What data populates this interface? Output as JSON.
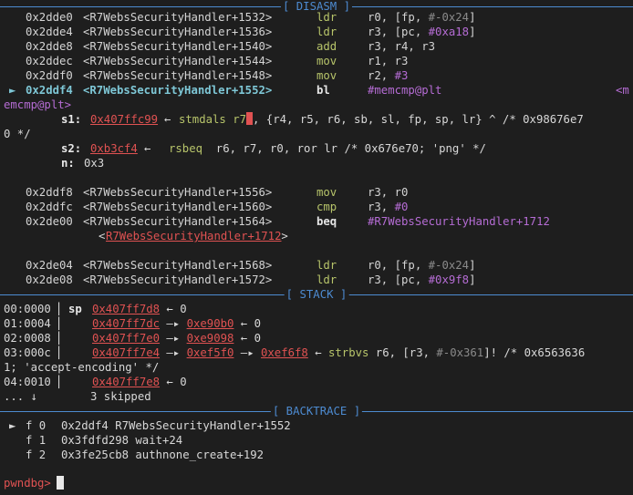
{
  "disasm": {
    "title": "[ DISASM ]",
    "rows": [
      {
        "marker": "",
        "addr": "0x2dde0",
        "sym": "<R7WebsSecurityHandler+1532>",
        "op": "ldr",
        "operands": [
          {
            "t": "r0, [fp, ",
            "c": "reg"
          },
          {
            "t": "#-0x24",
            "c": "neg"
          },
          {
            "t": "]",
            "c": "reg"
          }
        ]
      },
      {
        "marker": "",
        "addr": "0x2dde4",
        "sym": "<R7WebsSecurityHandler+1536>",
        "op": "ldr",
        "operands": [
          {
            "t": "r3, [pc, ",
            "c": "reg"
          },
          {
            "t": "#0xa18",
            "c": "hex"
          },
          {
            "t": "]",
            "c": "reg"
          }
        ]
      },
      {
        "marker": "",
        "addr": "0x2dde8",
        "sym": "<R7WebsSecurityHandler+1540>",
        "op": "add",
        "operands": [
          {
            "t": "r3, r4, r3",
            "c": "reg"
          }
        ]
      },
      {
        "marker": "",
        "addr": "0x2ddec",
        "sym": "<R7WebsSecurityHandler+1544>",
        "op": "mov",
        "operands": [
          {
            "t": "r1, r3",
            "c": "reg"
          }
        ]
      },
      {
        "marker": "",
        "addr": "0x2ddf0",
        "sym": "<R7WebsSecurityHandler+1548>",
        "op": "mov",
        "operands": [
          {
            "t": "r2, ",
            "c": "reg"
          },
          {
            "t": "#3",
            "c": "hex"
          }
        ]
      },
      {
        "marker": "►",
        "addr": "0x2ddf4",
        "sym": "<R7WebsSecurityHandler+1552>",
        "op": "bl",
        "operands": [
          {
            "t": "#memcmp@plt",
            "c": "hex"
          }
        ]
      }
    ],
    "current_right_tail": "<m",
    "current_wrap": "emcmp@plt",
    "current_wrap_end": ">",
    "args": [
      {
        "name": "s1:",
        "ptr": "0x407ffc99",
        "arrow": "←",
        "insn": "stmdals r7",
        "rest": ", {r4, r5, r6, sb, sl, fp, sp, lr} ^ /* 0x98676e7",
        "wrap": "0 */"
      },
      {
        "name": "s2:",
        "ptr": "0xb3cf4",
        "arrow": "←",
        "insn": "rsbeq",
        "rest": "  r6, r7, r0, ror lr /* 0x676e70; 'png' */"
      },
      {
        "name": "n:",
        "value": "0x3"
      }
    ],
    "rows2": [
      {
        "addr": "0x2ddf8",
        "sym": "<R7WebsSecurityHandler+1556>",
        "op": "mov",
        "operands": [
          {
            "t": "r3, r0",
            "c": "reg"
          }
        ]
      },
      {
        "addr": "0x2ddfc",
        "sym": "<R7WebsSecurityHandler+1560>",
        "op": "cmp",
        "operands": [
          {
            "t": "r3, ",
            "c": "reg"
          },
          {
            "t": "#0",
            "c": "hex"
          }
        ]
      },
      {
        "addr": "0x2de00",
        "sym": "<R7WebsSecurityHandler+1564>",
        "op": "beq",
        "operands": [
          {
            "t": "#R7WebsSecurityHandler+1712",
            "c": "hex"
          }
        ]
      }
    ],
    "beq_target": "R7WebsSecurityHandler+1712",
    "rows3": [
      {
        "addr": "0x2de04",
        "sym": "<R7WebsSecurityHandler+1568>",
        "op": "ldr",
        "operands": [
          {
            "t": "r0, [fp, ",
            "c": "reg"
          },
          {
            "t": "#-0x24",
            "c": "neg"
          },
          {
            "t": "]",
            "c": "reg"
          }
        ]
      },
      {
        "addr": "0x2de08",
        "sym": "<R7WebsSecurityHandler+1572>",
        "op": "ldr",
        "operands": [
          {
            "t": "r3, [pc, ",
            "c": "reg"
          },
          {
            "t": "#0x9f8",
            "c": "hex"
          },
          {
            "t": "]",
            "c": "reg"
          }
        ]
      }
    ]
  },
  "stack": {
    "title": "[ STACK ]",
    "rows": [
      {
        "idx": "00:0000",
        "reg": "sp",
        "chain": [
          {
            "t": "0x407ff7d8",
            "red": true
          }
        ],
        "tail": " ← 0"
      },
      {
        "idx": "01:0004",
        "reg": "",
        "chain": [
          {
            "t": "0x407ff7dc",
            "red": true
          },
          {
            "t": " —▸ ",
            "red": false
          },
          {
            "t": "0xe90b0",
            "red": true
          }
        ],
        "tail": " ← 0"
      },
      {
        "idx": "02:0008",
        "reg": "",
        "chain": [
          {
            "t": "0x407ff7e0",
            "red": true
          },
          {
            "t": " —▸ ",
            "red": false
          },
          {
            "t": "0xe9098",
            "red": true
          }
        ],
        "tail": " ← 0"
      },
      {
        "idx": "03:000c",
        "reg": "",
        "chain": [
          {
            "t": "0x407ff7e4",
            "red": true
          },
          {
            "t": " —▸ ",
            "red": false
          },
          {
            "t": "0xef5f0",
            "red": true
          },
          {
            "t": " —▸ ",
            "red": false
          },
          {
            "t": "0xef6f8",
            "red": true
          }
        ],
        "tail": " ← ",
        "insn": "strbvs",
        "insn_rest": " r6, [r3, ",
        "neg": "#-0x361",
        "insn_end": "]! /* 0x6563636",
        "wrap": "1; 'accept-encoding' */"
      },
      {
        "idx": "04:0010",
        "reg": "",
        "chain": [
          {
            "t": "0x407ff7e8",
            "red": true
          }
        ],
        "tail": " ← 0"
      }
    ],
    "skip_prefix": "... ↓",
    "skip_text": "3 skipped"
  },
  "backtrace": {
    "title": "[ BACKTRACE ]",
    "frames": [
      {
        "marker": "►",
        "frame": "f 0",
        "addr": "0x2ddf4",
        "sym": "R7WebsSecurityHandler+1552"
      },
      {
        "marker": "",
        "frame": "f 1",
        "addr": "0x3fdfd298",
        "sym": "wait+24"
      },
      {
        "marker": "",
        "frame": "f 2",
        "addr": "0x3fe25cb8",
        "sym": "authnone_create+192"
      }
    ]
  },
  "prompt": "pwndbg>"
}
